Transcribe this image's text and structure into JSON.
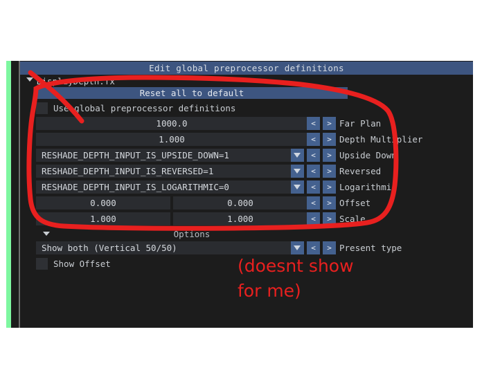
{
  "window": {
    "title": "Edit global preprocessor definitions",
    "tree_item": "DisplayDepth.fx",
    "reset_button": "Reset all to default",
    "options_header": "Options"
  },
  "icons": {
    "tree_expand": "triangle-down-icon",
    "dropdown": "chevron-down-icon",
    "prev": "<",
    "next": ">"
  },
  "checkboxes": [
    {
      "label": "Use global preprocessor definitions",
      "checked": false
    },
    {
      "label": "Show Offset",
      "checked": false
    }
  ],
  "rows": [
    {
      "label": "Far Plan",
      "kind": "number",
      "value": "1000.0",
      "dropdown": false,
      "prev": "<",
      "next": ">"
    },
    {
      "label": "Depth Multiplier",
      "kind": "number",
      "value": "1.000",
      "dropdown": false,
      "prev": "<",
      "next": ">"
    },
    {
      "label": "Upside Down",
      "kind": "text",
      "value": "RESHADE_DEPTH_INPUT_IS_UPSIDE_DOWN=1",
      "dropdown": true,
      "prev": "<",
      "next": ">"
    },
    {
      "label": "Reversed",
      "kind": "text",
      "value": "RESHADE_DEPTH_INPUT_IS_REVERSED=1",
      "dropdown": true,
      "prev": "<",
      "next": ">"
    },
    {
      "label": "Logarithmic",
      "kind": "text",
      "value": "RESHADE_DEPTH_INPUT_IS_LOGARITHMIC=0",
      "dropdown": true,
      "prev": "<",
      "next": ">"
    },
    {
      "label": "Offset",
      "kind": "number2",
      "value": "0.000",
      "value2": "0.000",
      "dropdown": false,
      "prev": "<",
      "next": ">"
    },
    {
      "label": "Scale",
      "kind": "number2",
      "value": "1.000",
      "value2": "1.000",
      "dropdown": false,
      "prev": "<",
      "next": ">"
    }
  ],
  "present_row": {
    "label": "Present type",
    "value": "Show both (Vertical 50/50)",
    "prev": "<",
    "next": ">"
  },
  "annotation": {
    "line1": "(doesnt show",
    "line2": "for me)",
    "color": "#e8201f"
  },
  "colors": {
    "panel_bg": "#1c1c1c",
    "title_blue": "#3d5580",
    "button_blue": "#44618f",
    "field_bg": "#2a2c30",
    "text": "#c9cdd2",
    "accent_green": "#7ef7a0",
    "annotation_red": "#e8201f"
  }
}
